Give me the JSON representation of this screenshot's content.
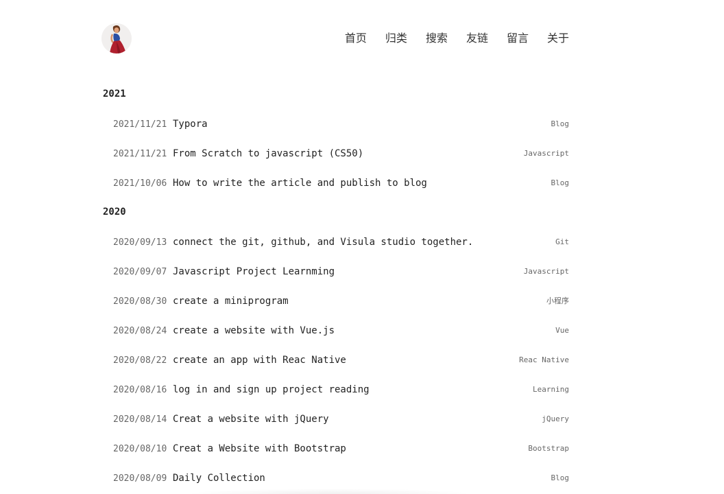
{
  "nav": [
    {
      "label": "首页"
    },
    {
      "label": "归类"
    },
    {
      "label": "搜索"
    },
    {
      "label": "友链"
    },
    {
      "label": "留言"
    },
    {
      "label": "关于"
    }
  ],
  "archive": [
    {
      "year": "2021",
      "posts": [
        {
          "date": "2021/11/21",
          "title": "Typora",
          "tag": "Blog"
        },
        {
          "date": "2021/11/21",
          "title": "From Scratch to javascript (CS50)",
          "tag": "Javascript"
        },
        {
          "date": "2021/10/06",
          "title": "How to write the article and publish to blog",
          "tag": "Blog"
        }
      ]
    },
    {
      "year": "2020",
      "posts": [
        {
          "date": "2020/09/13",
          "title": "connect the git, github, and Visula studio together.",
          "tag": "Git"
        },
        {
          "date": "2020/09/07",
          "title": "Javascript Project Learnming",
          "tag": "Javascript"
        },
        {
          "date": "2020/08/30",
          "title": "create a miniprogram",
          "tag": "小程序"
        },
        {
          "date": "2020/08/24",
          "title": "create a website with Vue.js",
          "tag": "Vue"
        },
        {
          "date": "2020/08/22",
          "title": "create an app with Reac Native",
          "tag": "Reac Native"
        },
        {
          "date": "2020/08/16",
          "title": "log in and sign up project reading",
          "tag": "Learning"
        },
        {
          "date": "2020/08/14",
          "title": "Creat a website with jQuery",
          "tag": "jQuery"
        },
        {
          "date": "2020/08/10",
          "title": "Creat a Website with Bootstrap",
          "tag": "Bootstrap"
        },
        {
          "date": "2020/08/09",
          "title": "Daily Collection",
          "tag": "Blog"
        }
      ]
    }
  ]
}
